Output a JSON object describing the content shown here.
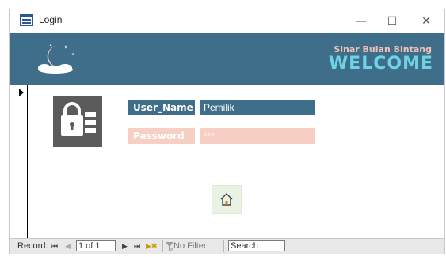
{
  "window": {
    "title": "Login",
    "minimize": "—",
    "maximize": "☐",
    "close": "✕"
  },
  "banner": {
    "subtitle": "Sinar Bulan Bintang",
    "title": "WELCOME",
    "logo_icon": "moon-stars-icon"
  },
  "form": {
    "username_label": "User_Name",
    "username_value": "Pemilik",
    "password_label": "Password",
    "password_value": "***",
    "lock_icon": "lock-list-icon",
    "home_icon": "home-icon"
  },
  "navbar": {
    "record_label": "Record:",
    "first": "⏮",
    "prev": "◀",
    "current": "1 of 1",
    "next": "▶",
    "last": "⏭",
    "new": "▶✱",
    "filter_label": "No Filter",
    "search_placeholder": "Search"
  },
  "colors": {
    "banner": "#3f6e8a",
    "welcome": "#6ed3e4",
    "subtitle": "#f3c2b6",
    "username_bg": "#3f6e8a",
    "password_bg": "#f7cfc4",
    "lock_bg": "#5b5b5b"
  }
}
